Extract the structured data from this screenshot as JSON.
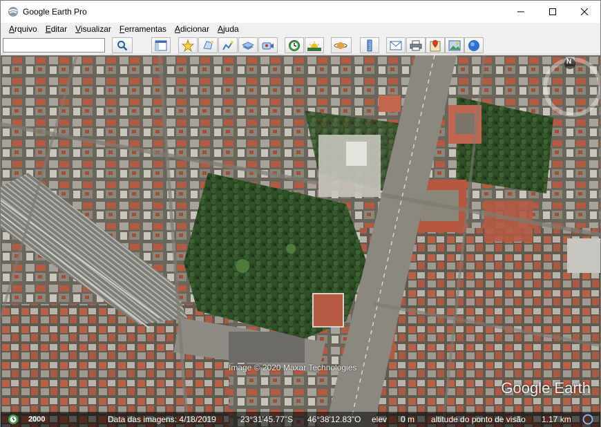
{
  "window": {
    "title": "Google Earth Pro"
  },
  "menu": [
    {
      "acc": "A",
      "rest": "rquivo"
    },
    {
      "acc": "E",
      "rest": "ditar"
    },
    {
      "acc": "V",
      "rest": "isualizar"
    },
    {
      "acc": "F",
      "rest": "erramentas"
    },
    {
      "acc": "A",
      "rest": "dicionar"
    },
    {
      "acc": "A",
      "rest": "juda"
    }
  ],
  "search": {
    "value": "",
    "placeholder": ""
  },
  "toolbar_icons": [
    "search-icon",
    "sidebar-icon",
    "placemark-icon",
    "polygon-icon",
    "path-icon",
    "overlay-icon",
    "tour-icon",
    "historical-imagery-icon",
    "sunlight-icon",
    "planets-icon",
    "ruler-icon",
    "email-icon",
    "print-icon",
    "maps-icon",
    "save-image-icon",
    "globe-icon"
  ],
  "map": {
    "copyright": "Image © 2020 Maxar Technologies",
    "watermark": "Google Earth",
    "compass_label": "N"
  },
  "status": {
    "year": "2000",
    "imagery_date": "Data das imagens: 4/18/2019",
    "lat": "23°31'45.77\"S",
    "lon": "46°38'12.83\"O",
    "elev_label": "elev",
    "elev_value": "0 m",
    "eye_alt_label": "altitude do ponto de visão",
    "eye_alt_value": "1.17 km"
  },
  "colors": {
    "park": "#2f4a25",
    "roof": "#b4573d",
    "road": "#8c8a84"
  }
}
